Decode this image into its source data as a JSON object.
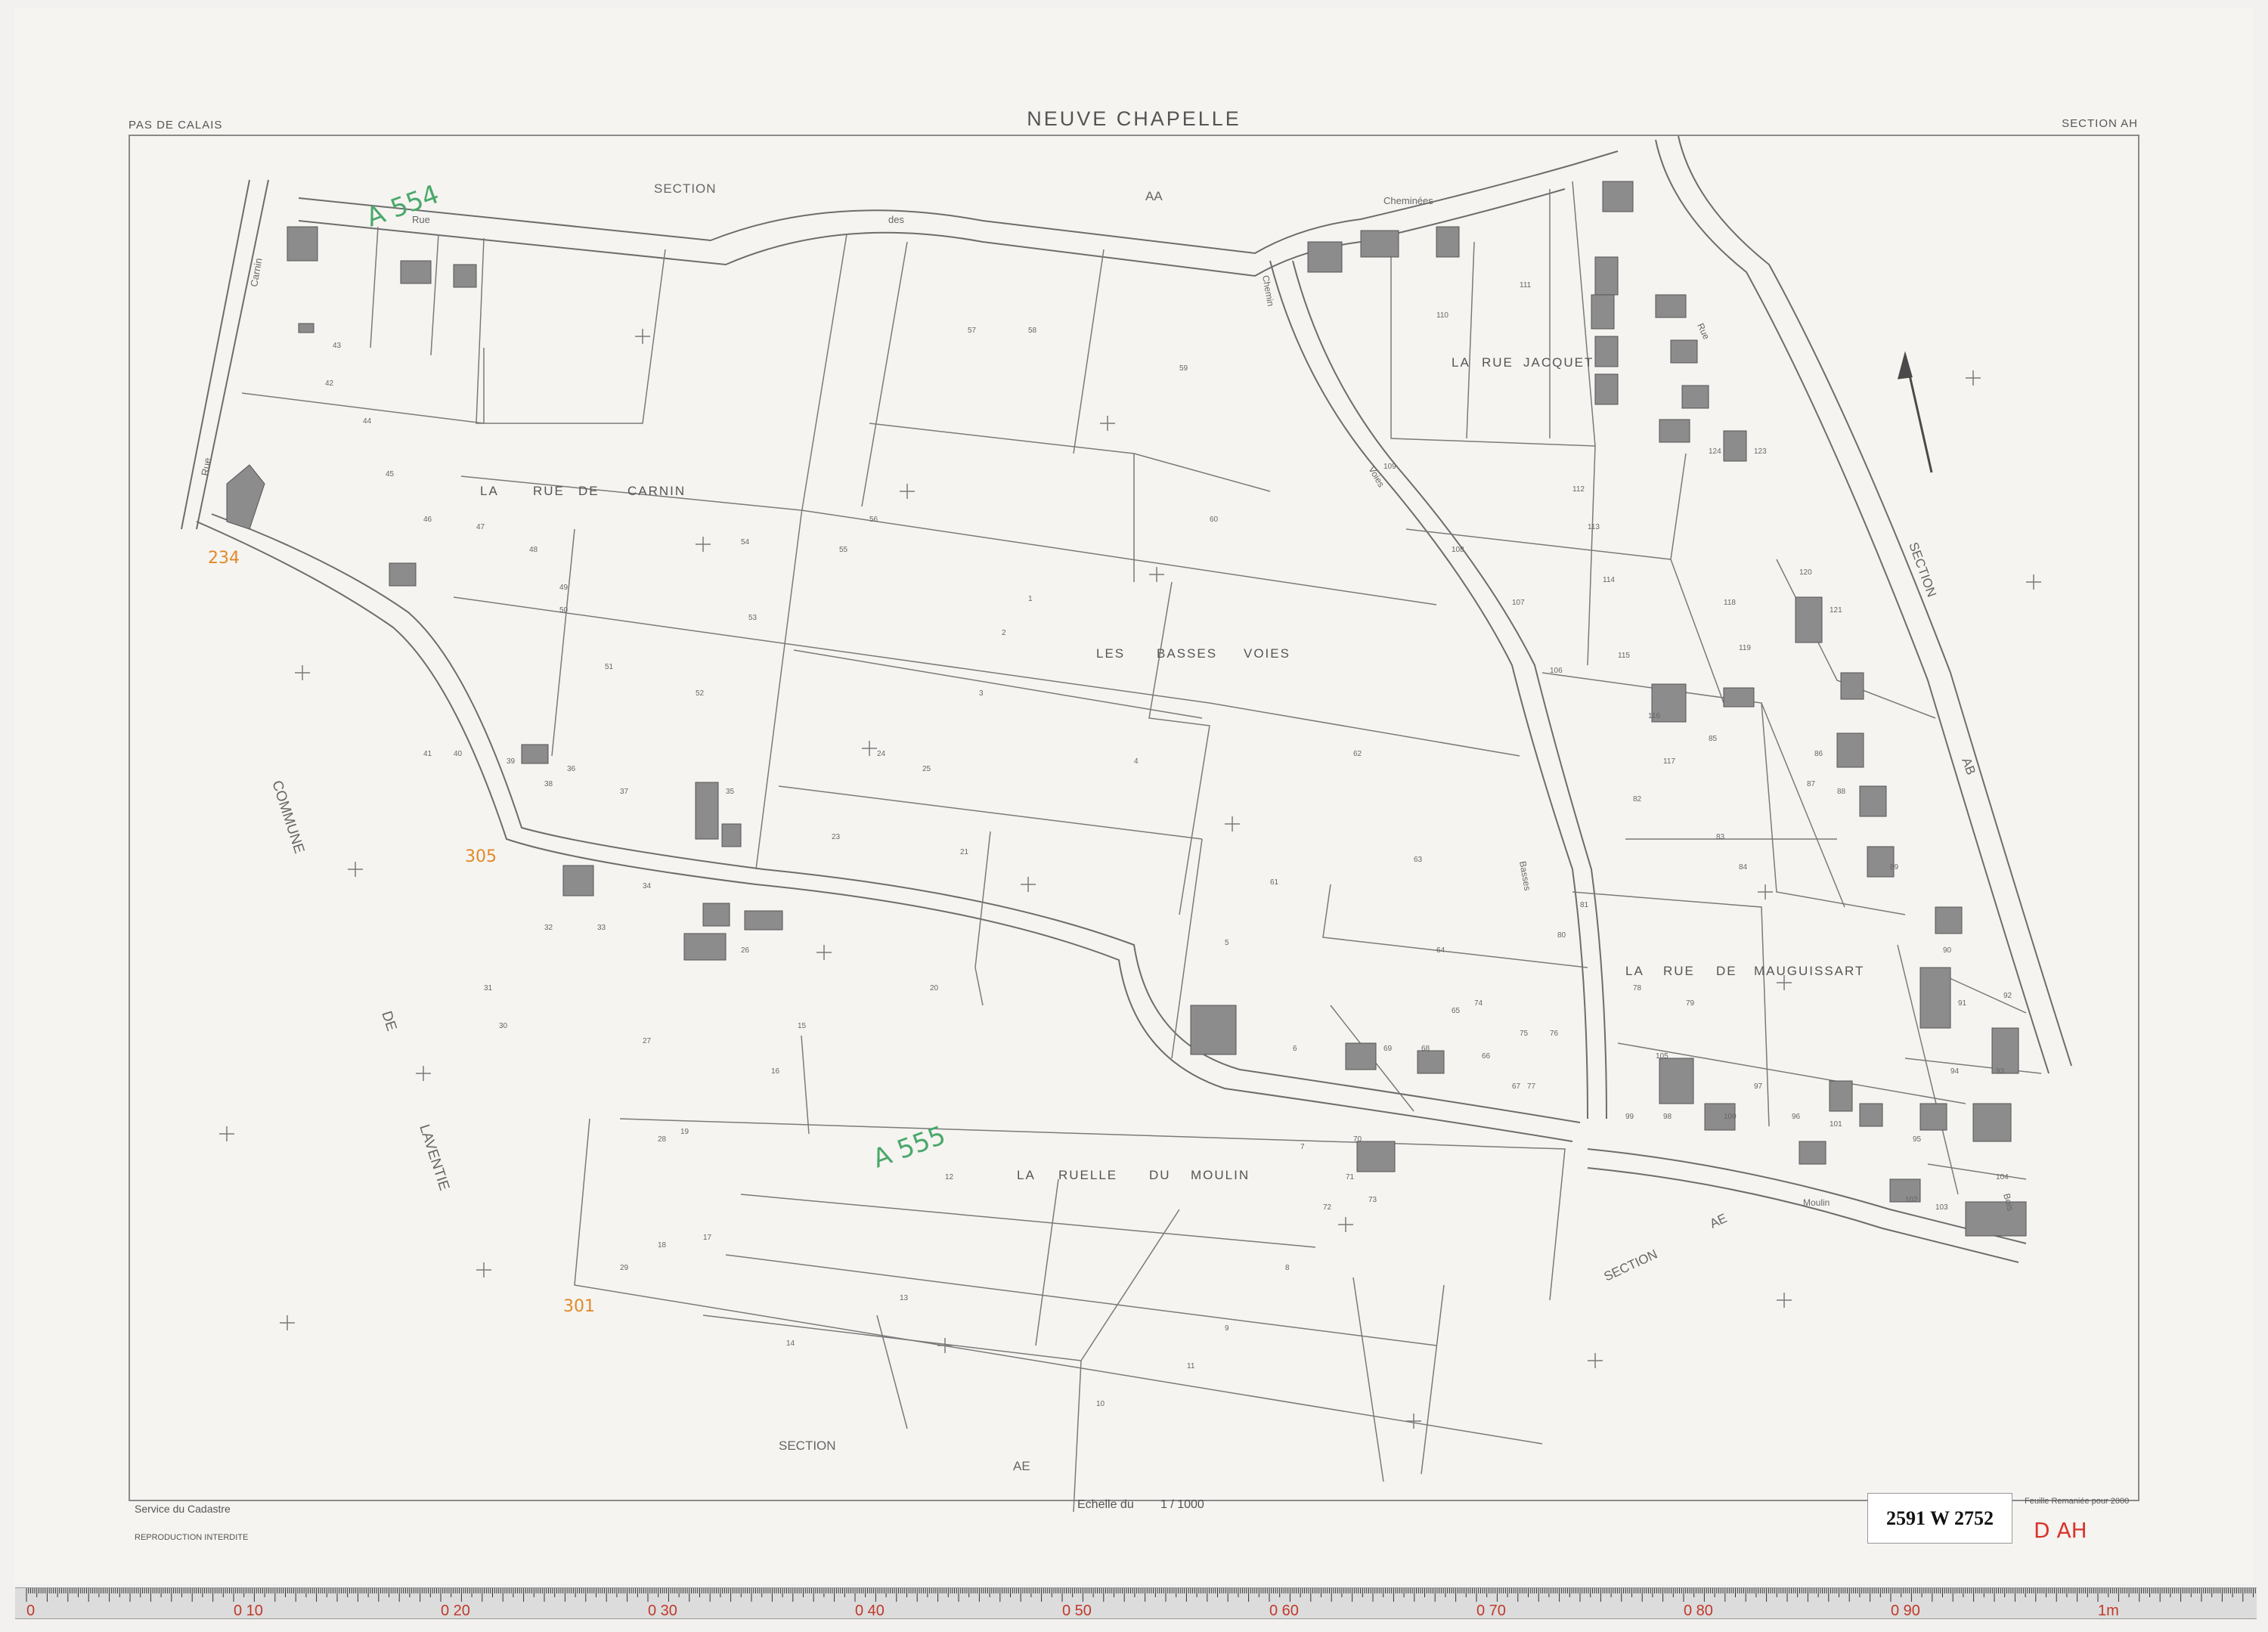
{
  "header": {
    "department": "PAS DE CALAIS",
    "commune": "NEUVE CHAPELLE",
    "section": "SECTION AH"
  },
  "labels": {
    "section_aa_1": "SECTION",
    "section_aa_2": "AA",
    "section_ab_1": "SECTION",
    "section_ab_2": "AB",
    "section_ae_right_1": "SECTION",
    "section_ae_right_2": "AE",
    "section_ae_bottom_1": "SECTION",
    "section_ae_bottom_2": "AE",
    "commune_laventie": [
      "COMMUNE",
      "DE",
      "LAVENTIE"
    ],
    "rue_des_cheminees": [
      "Rue",
      "des",
      "Cheminées"
    ],
    "rue_carnin": [
      "Rue",
      "du",
      "Carnin"
    ],
    "chemin_des_basses_voies": [
      "Chemin",
      "des",
      "Voies",
      "Basses"
    ],
    "rue_du_bois": [
      "Rue",
      "du",
      "Bois"
    ],
    "rue_du_moulin": "Moulin",
    "localities": {
      "rue_de_carnin": [
        "LA",
        "RUE",
        "DE",
        "CARNIN"
      ],
      "basses_voies": [
        "LES",
        "BASSES",
        "VOIES"
      ],
      "rue_jacquet": [
        "LA",
        "RUE",
        "JACQUET"
      ],
      "mauguissart": [
        "LA",
        "RUE",
        "DE",
        "MAUGUISSART"
      ],
      "ruelle_moulin": [
        "LA",
        "RUELLE",
        "DU",
        "MOULIN"
      ]
    }
  },
  "annotations": {
    "green_top": "A 554",
    "green_center": "A 555",
    "orange_1": "234",
    "orange_2": "305",
    "orange_3": "301"
  },
  "parcel_numbers": [
    "1",
    "2",
    "3",
    "4",
    "5",
    "6",
    "7",
    "8",
    "9",
    "10",
    "11",
    "12",
    "13",
    "14",
    "15",
    "16",
    "17",
    "18",
    "19",
    "20",
    "21",
    "23",
    "24",
    "25",
    "26",
    "27",
    "28",
    "29",
    "30",
    "31",
    "32",
    "33",
    "34",
    "35",
    "36",
    "37",
    "38",
    "39",
    "40",
    "41",
    "42",
    "43",
    "44",
    "45",
    "46",
    "47",
    "48",
    "49",
    "50",
    "51",
    "52",
    "53",
    "54",
    "55",
    "56",
    "57",
    "58",
    "59",
    "60",
    "61",
    "62",
    "63",
    "64",
    "65",
    "66",
    "67",
    "68",
    "69",
    "70",
    "71",
    "72",
    "73",
    "74",
    "75",
    "76",
    "77",
    "78",
    "79",
    "80",
    "81",
    "82",
    "83",
    "84",
    "85",
    "86",
    "87",
    "88",
    "89",
    "90",
    "91",
    "92",
    "93",
    "94",
    "95",
    "96",
    "97",
    "98",
    "99",
    "100",
    "101",
    "102",
    "103",
    "104",
    "105",
    "106",
    "107",
    "108",
    "109",
    "110",
    "111",
    "112",
    "113",
    "114",
    "115",
    "116",
    "117",
    "118",
    "119",
    "120",
    "121",
    "123",
    "124"
  ],
  "footer": {
    "service": "Service du Cadastre",
    "reproduction": "REPRODUCTION INTERDITE",
    "scale_label": "Echelle du",
    "scale_value": "1 / 1000",
    "remaniee": "Feuille Remaniée pour 2000",
    "archive_ref": "2591 W 2752",
    "hand_ref": "D AH"
  },
  "ruler": {
    "unit_labels": [
      "0",
      "0 10",
      "0 20",
      "0 30",
      "0 40",
      "0 50",
      "0 60",
      "0 70",
      "0 80",
      "0 90",
      "1m"
    ]
  },
  "colors": {
    "paper": "#f5f4f1",
    "line": "#6d6d6d",
    "building": "#8c8c8c",
    "green_ink": "#4aa86a",
    "orange_ink": "#e08a2a",
    "red_ink": "#d9342b"
  }
}
